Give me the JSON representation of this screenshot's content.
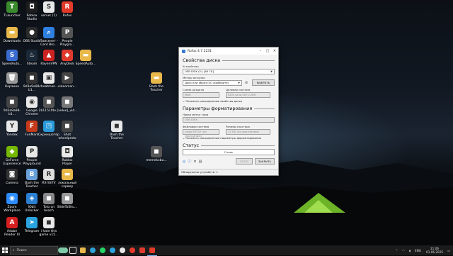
{
  "desktop": {
    "icons": [
      {
        "label": "TLauncher",
        "color": "#3a8a2e",
        "glyph": "T"
      },
      {
        "label": "Roblox Studio",
        "color": "#1c1c1c",
        "glyph": "◘"
      },
      {
        "label": "server (1)",
        "color": "#e8e8e8",
        "glyph": "S"
      },
      {
        "label": "Rufus",
        "color": "#e23a2a",
        "glyph": "R"
      },
      {
        "label": "Downloads",
        "color": "#e8b84a",
        "glyph": "▬"
      },
      {
        "label": "OBS Studio",
        "color": "#2a2a2a",
        "glyph": "●"
      },
      {
        "label": "Поискнет - Cent Bro...",
        "color": "#2f7fe0",
        "glyph": "⌕"
      },
      {
        "label": "People Playgro...",
        "color": "#555",
        "glyph": "P"
      },
      {
        "label": "SpeedAuto...",
        "color": "#3a6cd0",
        "glyph": "S"
      },
      {
        "label": "Steam",
        "color": "#1b2838",
        "glyph": "♨"
      },
      {
        "label": "RavenVPN",
        "color": "#c22",
        "glyph": "▲"
      },
      {
        "label": "AnyDesk",
        "color": "#e03a2e",
        "glyph": "◆"
      },
      {
        "label": "SpeedAuto...",
        "color": "#e8b84a",
        "glyph": "▬"
      },
      {
        "label": "Корзина",
        "color": "#999",
        "glyph": "🗑"
      },
      {
        "label": "9d3a9a98-b1...",
        "color": "#333",
        "glyph": "◼"
      },
      {
        "label": "cheatmen...",
        "color": "#e8e8e8",
        "glyph": "▣"
      },
      {
        "label": "videoman...",
        "color": "#444",
        "glyph": "▶"
      },
      {
        "label": "9d3a9a98-b1...",
        "color": "#444",
        "glyph": "◼"
      },
      {
        "label": "Google Chrome",
        "color": "#e8e8e8",
        "glyph": "◉"
      },
      {
        "label": "2b1151f4e...",
        "color": "#555",
        "glyph": "◼"
      },
      {
        "label": "[video]_vid...",
        "color": "#777",
        "glyph": "◼"
      },
      {
        "label": "Yandex",
        "color": "#e8e8e8",
        "glyph": "Y"
      },
      {
        "label": "FunMark",
        "color": "#c53a1a",
        "glyph": "F"
      },
      {
        "label": "Скриншотер",
        "color": "#2a9ad8",
        "glyph": "◳"
      },
      {
        "label": "Shot wheelproto",
        "color": "#444",
        "glyph": "◼"
      },
      {
        "label": "GeForce Experience",
        "color": "#76b900",
        "glyph": "◆"
      },
      {
        "label": "People Playground",
        "color": "#e8e8e8",
        "glyph": "P"
      },
      {
        "label": "Roblox Player",
        "color": "#e8e8e8",
        "glyph": "◘"
      },
      {
        "label": "Camera",
        "color": "#333",
        "glyph": "◙"
      },
      {
        "label": "Bash the Teacher",
        "color": "#6aa0d8",
        "glyph": "B"
      },
      {
        "label": "RX-SSTV",
        "color": "#ddd",
        "glyph": "R"
      },
      {
        "label": "локальный сервер",
        "color": "#e8b84a",
        "glyph": "▬"
      },
      {
        "label": "Zoom Workplace",
        "color": "#2d8cff",
        "glyph": "◉"
      },
      {
        "label": "IObit Unlocker",
        "color": "#2a7fd0",
        "glyph": "◈"
      },
      {
        "label": "Toto on beach",
        "color": "#888",
        "glyph": "◼"
      },
      {
        "label": "SlideToShu...",
        "color": "#999",
        "glyph": "◼"
      },
      {
        "label": "Adobe Reader XI",
        "color": "#d42020",
        "glyph": "A"
      },
      {
        "label": "Telegram",
        "color": "#2aa3de",
        "glyph": "➤"
      },
      {
        "label": "i hate this game v15...",
        "color": "#e8e8e8",
        "glyph": "◼"
      },
      {
        "label": "Bash the Teacher",
        "color": "#e8b84a",
        "glyph": "▬"
      },
      {
        "label": "Bash the Teacher",
        "color": "#e8e8e8",
        "glyph": "◼"
      },
      {
        "label": "memekxbu...",
        "color": "#555",
        "glyph": "◼"
      }
    ]
  },
  "rufus": {
    "title": "Rufus 4.7.2231",
    "drive_props_heading": "Свойства диска",
    "device_label": "Устройство",
    "device_value": "USB DISK (E:) [64 ГБ]",
    "boot_label": "Метод загрузки",
    "boot_value": "Диск или образ ISO (выберите)",
    "select_button": "ВЫБРАТЬ",
    "partition_label": "Схема раздела",
    "partition_value": "MBR",
    "target_label": "Целевая система",
    "target_value": "BIOS (или UEFI-CSM)",
    "adv_drive": "Показать расширенные свойства диска",
    "format_heading": "Параметры форматирования",
    "volume_label": "Новая метка тома",
    "volume_value": "USB DISK",
    "fs_label": "Файловая система",
    "fs_value": "Large FAT32 (по умолчанию)",
    "cluster_label": "Размер кластера",
    "cluster_value": "32 КБ (по умолчанию)",
    "adv_format": "Показать расширенные параметры форматирования",
    "status_heading": "Статус",
    "status_value": "Готов",
    "start_button": "СТАРТ",
    "close_button": "ЗАКРЫТЬ",
    "statusbar": "Обнаружено устройств: 1"
  },
  "taskbar": {
    "search_placeholder": "Поиск",
    "time": "21:06",
    "date": "01.06.2025",
    "lang": "ENG"
  }
}
